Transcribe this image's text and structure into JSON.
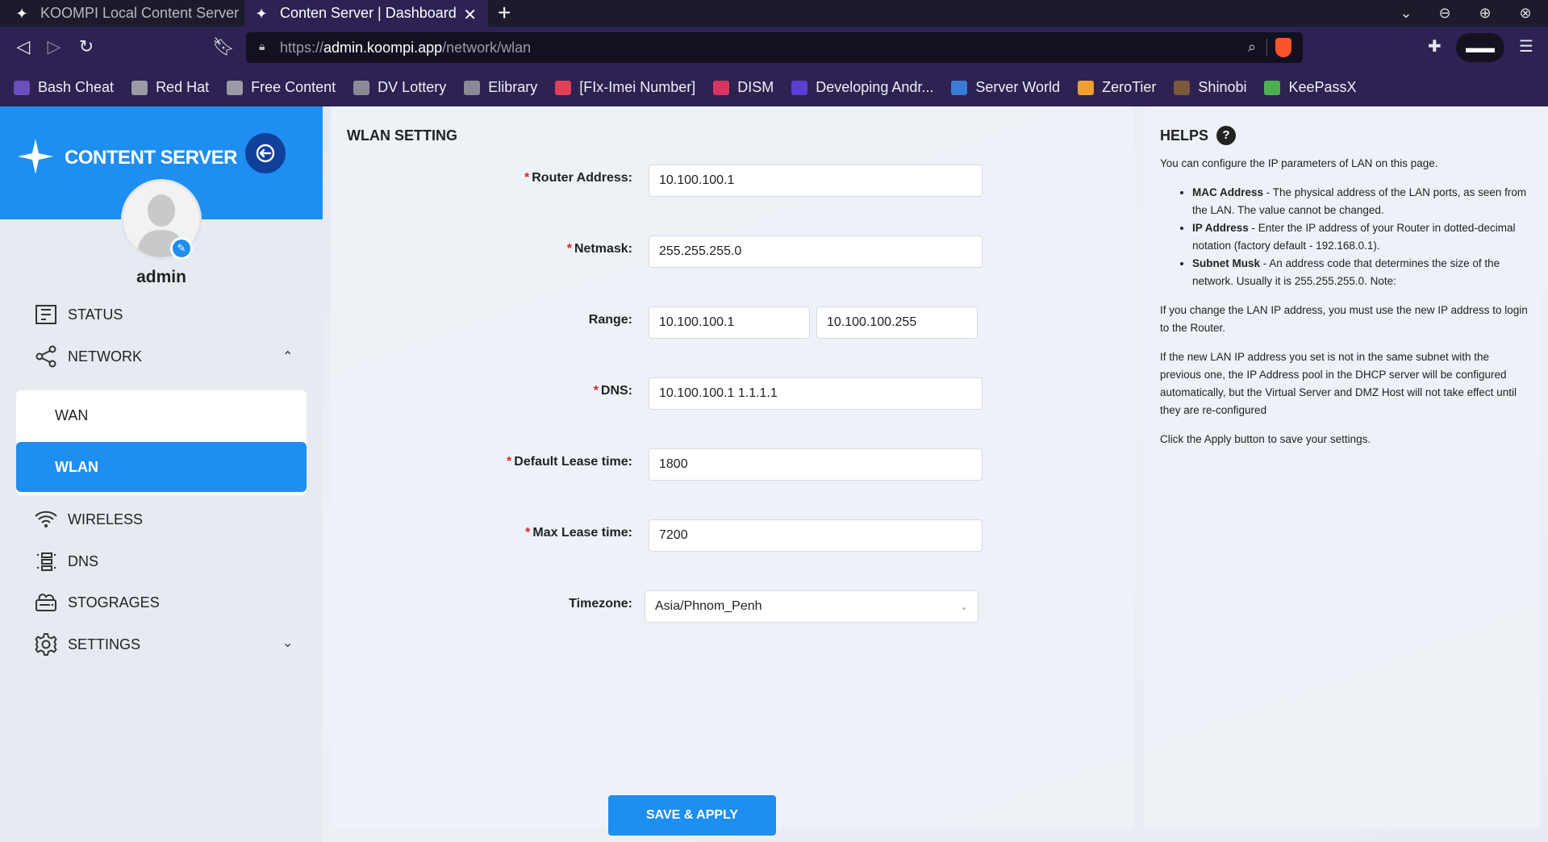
{
  "browser": {
    "tabs": [
      {
        "label": "KOOMPI Local Content Server",
        "active": false
      },
      {
        "label": "Conten Server | Dashboard",
        "active": true
      }
    ],
    "url_scheme": "https://",
    "url_host": "admin.koompi.app",
    "url_path": "/network/wlan",
    "bookmarks": [
      {
        "label": "Bash Cheat",
        "icon": "bash-icon",
        "color": "#6b4fbb"
      },
      {
        "label": "Red Hat",
        "icon": "folder-icon",
        "color": "#9a9aa4"
      },
      {
        "label": "Free Content",
        "icon": "folder-icon",
        "color": "#9a9aa4"
      },
      {
        "label": "DV Lottery",
        "icon": "globe-icon",
        "color": "#8a8a96"
      },
      {
        "label": "Elibrary",
        "icon": "globe-icon",
        "color": "#8a8a96"
      },
      {
        "label": "[FIx-Imei Number]",
        "icon": "tool-icon",
        "color": "#e0405a"
      },
      {
        "label": "DISM",
        "icon": "wave-icon",
        "color": "#d8345f"
      },
      {
        "label": "Developing Andr...",
        "icon": "udemy-icon",
        "color": "#5b3fd0"
      },
      {
        "label": "Server World",
        "icon": "server-icon",
        "color": "#3a7bd5"
      },
      {
        "label": "ZeroTier",
        "icon": "zerotier-icon",
        "color": "#f0a030"
      },
      {
        "label": "Shinobi",
        "icon": "ninja-icon",
        "color": "#7a5a3a"
      },
      {
        "label": "KeePassX",
        "icon": "key-icon",
        "color": "#4caf50"
      }
    ]
  },
  "sidebar": {
    "brand": "CONTENT SERVER",
    "username": "admin",
    "menu": {
      "status": "STATUS",
      "network": "NETWORK",
      "wan": "WAN",
      "wlan": "WLAN",
      "wireless": "WIRELESS",
      "dns": "DNS",
      "storages": "STOGRAGES",
      "settings": "SETTINGS"
    }
  },
  "form": {
    "title": "WLAN SETTING",
    "router_address": {
      "label": "Router Address",
      "value": "10.100.100.1"
    },
    "netmask": {
      "label": "Netmask",
      "value": "255.255.255.0"
    },
    "range": {
      "label": "Range",
      "start": "10.100.100.1",
      "end": "10.100.100.255"
    },
    "dns": {
      "label": "DNS",
      "value": "10.100.100.1 1.1.1.1"
    },
    "default_lease": {
      "label": "Default Lease time",
      "value": "1800"
    },
    "max_lease": {
      "label": "Max Lease time",
      "value": "7200"
    },
    "timezone": {
      "label": "Timezone",
      "value": "Asia/Phnom_Penh"
    },
    "save_label": "SAVE & APPLY",
    "colon": ":"
  },
  "help": {
    "title": "HELPS",
    "intro": "You can configure the IP parameters of LAN on this page.",
    "items": [
      {
        "term": "MAC Address",
        "desc": " - The physical address of the LAN ports, as seen from the LAN. The value cannot be changed."
      },
      {
        "term": "IP Address",
        "desc": " - Enter the IP address of your Router in dotted-decimal notation (factory default - 192.168.0.1)."
      },
      {
        "term": "Subnet Musk",
        "desc": " - An address code that determines the size of the network. Usually it is 255.255.255.0. Note:"
      }
    ],
    "para1": "If you change the LAN IP address, you must use the new IP address to login to the Router.",
    "para2": "If the new LAN IP address you set is not in the same subnet with the previous one, the IP Address pool in the DHCP server will be configured automatically, but the Virtual Server and DMZ Host will not take effect until they are re-configured",
    "para3": "Click the Apply button to save your settings."
  },
  "colors": {
    "accent": "#1e8ef0",
    "required": "#e02020",
    "browser_bar": "#2d2252"
  }
}
